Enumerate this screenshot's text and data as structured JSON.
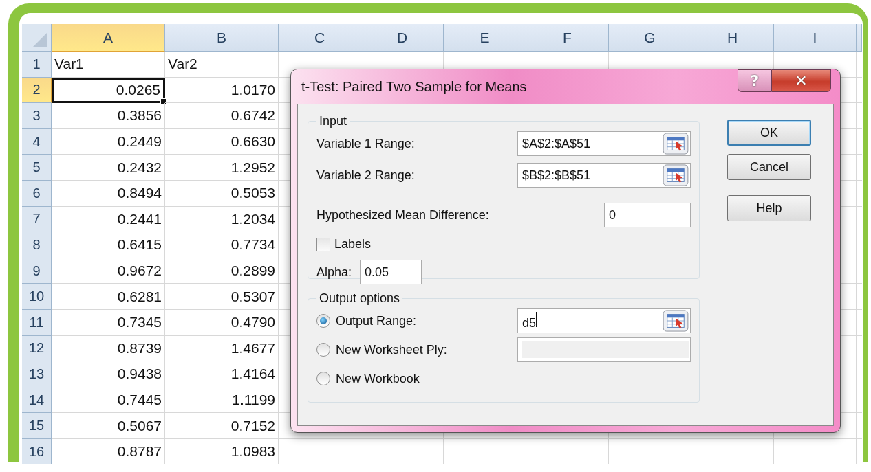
{
  "sheet": {
    "columns": [
      {
        "label": "A",
        "selected": true
      },
      {
        "label": "B",
        "selected": false
      },
      {
        "label": "C",
        "selected": false
      },
      {
        "label": "D",
        "selected": false
      },
      {
        "label": "E",
        "selected": false
      },
      {
        "label": "F",
        "selected": false
      },
      {
        "label": "G",
        "selected": false
      },
      {
        "label": "H",
        "selected": false
      },
      {
        "label": "I",
        "selected": false
      }
    ],
    "rows": [
      {
        "number": "1",
        "selected": false,
        "cells": [
          {
            "text": "Var1",
            "kind": "text",
            "active": false
          },
          {
            "text": "Var2",
            "kind": "text",
            "active": false
          }
        ]
      },
      {
        "number": "2",
        "selected": true,
        "cells": [
          {
            "text": "0.0265",
            "kind": "number",
            "active": true
          },
          {
            "text": "1.0170",
            "kind": "number",
            "active": false
          }
        ]
      },
      {
        "number": "3",
        "selected": false,
        "cells": [
          {
            "text": "0.3856",
            "kind": "number",
            "active": false
          },
          {
            "text": "0.6742",
            "kind": "number",
            "active": false
          }
        ]
      },
      {
        "number": "4",
        "selected": false,
        "cells": [
          {
            "text": "0.2449",
            "kind": "number",
            "active": false
          },
          {
            "text": "0.6630",
            "kind": "number",
            "active": false
          }
        ]
      },
      {
        "number": "5",
        "selected": false,
        "cells": [
          {
            "text": "0.2432",
            "kind": "number",
            "active": false
          },
          {
            "text": "1.2952",
            "kind": "number",
            "active": false
          }
        ]
      },
      {
        "number": "6",
        "selected": false,
        "cells": [
          {
            "text": "0.8494",
            "kind": "number",
            "active": false
          },
          {
            "text": "0.5053",
            "kind": "number",
            "active": false
          }
        ]
      },
      {
        "number": "7",
        "selected": false,
        "cells": [
          {
            "text": "0.2441",
            "kind": "number",
            "active": false
          },
          {
            "text": "1.2034",
            "kind": "number",
            "active": false
          }
        ]
      },
      {
        "number": "8",
        "selected": false,
        "cells": [
          {
            "text": "0.6415",
            "kind": "number",
            "active": false
          },
          {
            "text": "0.7734",
            "kind": "number",
            "active": false
          }
        ]
      },
      {
        "number": "9",
        "selected": false,
        "cells": [
          {
            "text": "0.9672",
            "kind": "number",
            "active": false
          },
          {
            "text": "0.2899",
            "kind": "number",
            "active": false
          }
        ]
      },
      {
        "number": "10",
        "selected": false,
        "cells": [
          {
            "text": "0.6281",
            "kind": "number",
            "active": false
          },
          {
            "text": "0.5307",
            "kind": "number",
            "active": false
          }
        ]
      },
      {
        "number": "11",
        "selected": false,
        "cells": [
          {
            "text": "0.7345",
            "kind": "number",
            "active": false
          },
          {
            "text": "0.4790",
            "kind": "number",
            "active": false
          }
        ]
      },
      {
        "number": "12",
        "selected": false,
        "cells": [
          {
            "text": "0.8739",
            "kind": "number",
            "active": false
          },
          {
            "text": "1.4677",
            "kind": "number",
            "active": false
          }
        ]
      },
      {
        "number": "13",
        "selected": false,
        "cells": [
          {
            "text": "0.9438",
            "kind": "number",
            "active": false
          },
          {
            "text": "1.4164",
            "kind": "number",
            "active": false
          }
        ]
      },
      {
        "number": "14",
        "selected": false,
        "cells": [
          {
            "text": "0.7445",
            "kind": "number",
            "active": false
          },
          {
            "text": "1.1199",
            "kind": "number",
            "active": false
          }
        ]
      },
      {
        "number": "15",
        "selected": false,
        "cells": [
          {
            "text": "0.5067",
            "kind": "number",
            "active": false
          },
          {
            "text": "0.7152",
            "kind": "number",
            "active": false
          }
        ]
      },
      {
        "number": "16",
        "selected": false,
        "cells": [
          {
            "text": "0.8787",
            "kind": "number",
            "active": false
          },
          {
            "text": "1.0983",
            "kind": "number",
            "active": false
          }
        ]
      }
    ]
  },
  "dialog": {
    "title": "t-Test: Paired Two Sample for Means",
    "help_button": "?",
    "close_button": "✕",
    "input": {
      "legend": "Input",
      "ranges": [
        {
          "label": "Variable 1 Range:",
          "value": "$A$2:$A$51"
        },
        {
          "label": "Variable 2 Range:",
          "value": "$B$2:$B$51"
        }
      ],
      "mean_difference": {
        "label": "Hypothesized Mean Difference:",
        "value": "0"
      },
      "labels": {
        "label": "Labels",
        "checked": false
      },
      "alpha": {
        "label": "Alpha:",
        "value": "0.05"
      }
    },
    "output": {
      "legend": "Output options",
      "options": [
        {
          "label": "Output Range:",
          "selected": true,
          "kind": "range",
          "value": "d5",
          "focused": true
        },
        {
          "label": "New Worksheet Ply:",
          "selected": false,
          "kind": "field",
          "disabled": true
        },
        {
          "label": "New Workbook",
          "selected": false,
          "kind": "none"
        }
      ]
    },
    "buttons": [
      {
        "label": "OK",
        "default": true
      },
      {
        "label": "Cancel",
        "default": false
      },
      {
        "label": "Help",
        "default": false
      }
    ]
  }
}
